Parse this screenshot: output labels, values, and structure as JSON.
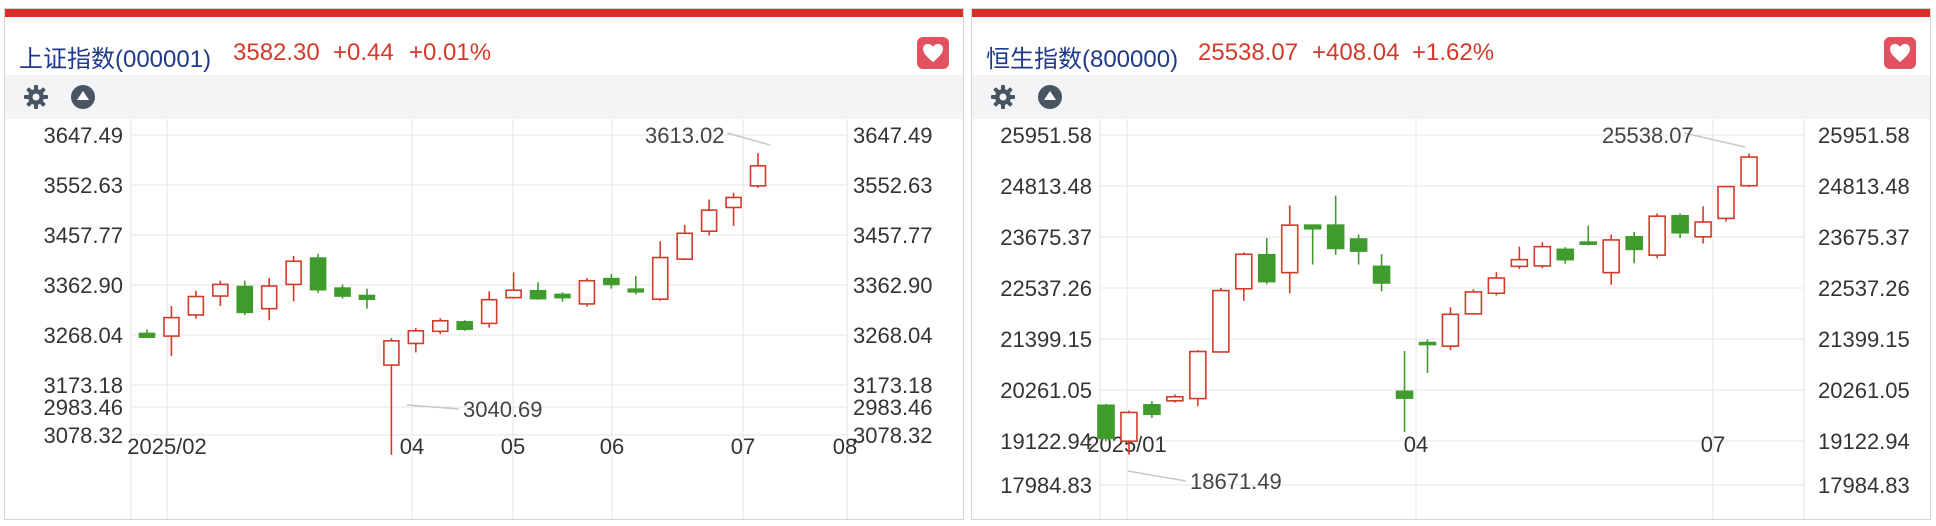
{
  "colors": {
    "up": "#d23a2a",
    "down": "#3f9b2c",
    "accent": "#d9302b",
    "title": "#1f3a8a",
    "fav": "#e05260"
  },
  "icons": {
    "favorite": "heart-icon",
    "settings": "gear-icon",
    "collapse": "collapse-up-icon"
  },
  "panels": [
    {
      "header": {
        "title": "上证指数(000001)",
        "price": "3582.30",
        "change": "+0.44",
        "percent": "+0.01%"
      },
      "chart_data": {
        "type": "candlestick",
        "y_ticks": [
          "3647.49",
          "3552.63",
          "3457.77",
          "3362.90",
          "3268.04",
          "3173.18",
          "3078.32",
          "2983.46"
        ],
        "x_ticks": [
          "2025/02",
          "04",
          "05",
          "06",
          "07",
          "08"
        ],
        "annotations": {
          "high": "3613.02",
          "low": "3040.69"
        },
        "candles": [
          {
            "o": 3271,
            "c": 3264,
            "h": 3279,
            "l": 3262
          },
          {
            "o": 3266,
            "c": 3301,
            "h": 3323,
            "l": 3228
          },
          {
            "o": 3306,
            "c": 3341,
            "h": 3352,
            "l": 3299
          },
          {
            "o": 3342,
            "c": 3364,
            "h": 3371,
            "l": 3323
          },
          {
            "o": 3360,
            "c": 3311,
            "h": 3371,
            "l": 3306
          },
          {
            "o": 3318,
            "c": 3361,
            "h": 3376,
            "l": 3296
          },
          {
            "o": 3364,
            "c": 3408,
            "h": 3418,
            "l": 3332
          },
          {
            "o": 3414,
            "c": 3354,
            "h": 3422,
            "l": 3348
          },
          {
            "o": 3357,
            "c": 3342,
            "h": 3364,
            "l": 3337
          },
          {
            "o": 3343,
            "c": 3336,
            "h": 3356,
            "l": 3318
          },
          {
            "o": 3211,
            "c": 3257,
            "h": 3262,
            "l": 3040.69
          },
          {
            "o": 3252,
            "c": 3276,
            "h": 3281,
            "l": 3235
          },
          {
            "o": 3275,
            "c": 3295,
            "h": 3300,
            "l": 3270
          },
          {
            "o": 3293,
            "c": 3279,
            "h": 3296,
            "l": 3276
          },
          {
            "o": 3290,
            "c": 3335,
            "h": 3351,
            "l": 3282
          },
          {
            "o": 3339,
            "c": 3353,
            "h": 3387,
            "l": 3337
          },
          {
            "o": 3352,
            "c": 3337,
            "h": 3368,
            "l": 3335
          },
          {
            "o": 3345,
            "c": 3339,
            "h": 3349,
            "l": 3331
          },
          {
            "o": 3327,
            "c": 3371,
            "h": 3376,
            "l": 3322
          },
          {
            "o": 3375,
            "c": 3364,
            "h": 3384,
            "l": 3356
          },
          {
            "o": 3355,
            "c": 3350,
            "h": 3380,
            "l": 3345
          },
          {
            "o": 3336,
            "c": 3415,
            "h": 3446,
            "l": 3333
          },
          {
            "o": 3412,
            "c": 3461,
            "h": 3477,
            "l": 3410
          },
          {
            "o": 3465,
            "c": 3505,
            "h": 3525,
            "l": 3457
          },
          {
            "o": 3510,
            "c": 3529,
            "h": 3538,
            "l": 3475
          },
          {
            "o": 3551,
            "c": 3589,
            "h": 3613.02,
            "l": 3547
          }
        ]
      }
    },
    {
      "header": {
        "title": "恒生指数(800000)",
        "price": "25538.07",
        "change": "+408.04",
        "percent": "+1.62%"
      },
      "chart_data": {
        "type": "candlestick",
        "y_ticks": [
          "25951.58",
          "24813.48",
          "23675.37",
          "22537.26",
          "21399.15",
          "20261.05",
          "19122.94",
          "17984.83"
        ],
        "x_ticks": [
          "2025/01",
          "04",
          "07"
        ],
        "annotations": {
          "high": "25538.07",
          "low": "18671.49"
        },
        "candles": [
          {
            "o": 19920,
            "c": 19180,
            "h": 19950,
            "l": 19120
          },
          {
            "o": 19120,
            "c": 19760,
            "h": 19800,
            "l": 18820
          },
          {
            "o": 19930,
            "c": 19720,
            "h": 20010,
            "l": 19640
          },
          {
            "o": 20020,
            "c": 20110,
            "h": 20160,
            "l": 19980
          },
          {
            "o": 20070,
            "c": 21120,
            "h": 21150,
            "l": 19900
          },
          {
            "o": 21110,
            "c": 22480,
            "h": 22540,
            "l": 21090
          },
          {
            "o": 22520,
            "c": 23290,
            "h": 23330,
            "l": 22250
          },
          {
            "o": 23280,
            "c": 22680,
            "h": 23650,
            "l": 22620
          },
          {
            "o": 22880,
            "c": 23940,
            "h": 24380,
            "l": 22420
          },
          {
            "o": 23940,
            "c": 23860,
            "h": 23950,
            "l": 23060
          },
          {
            "o": 23940,
            "c": 23420,
            "h": 24600,
            "l": 23280
          },
          {
            "o": 23630,
            "c": 23360,
            "h": 23730,
            "l": 23060
          },
          {
            "o": 23020,
            "c": 22650,
            "h": 23290,
            "l": 22460
          },
          {
            "o": 20230,
            "c": 20080,
            "h": 21130,
            "l": 19320
          },
          {
            "o": 21320,
            "c": 21300,
            "h": 21390,
            "l": 20640
          },
          {
            "o": 21240,
            "c": 21950,
            "h": 22110,
            "l": 21150
          },
          {
            "o": 21960,
            "c": 22450,
            "h": 22510,
            "l": 21980
          },
          {
            "o": 22420,
            "c": 22760,
            "h": 22890,
            "l": 22370
          },
          {
            "o": 23020,
            "c": 23170,
            "h": 23460,
            "l": 22960
          },
          {
            "o": 23030,
            "c": 23460,
            "h": 23560,
            "l": 22980
          },
          {
            "o": 23400,
            "c": 23170,
            "h": 23450,
            "l": 23080
          },
          {
            "o": 23560,
            "c": 23530,
            "h": 23930,
            "l": 23490
          },
          {
            "o": 22880,
            "c": 23610,
            "h": 23730,
            "l": 22610
          },
          {
            "o": 23680,
            "c": 23400,
            "h": 23790,
            "l": 23090
          },
          {
            "o": 23270,
            "c": 24140,
            "h": 24200,
            "l": 23200
          },
          {
            "o": 24150,
            "c": 23770,
            "h": 24200,
            "l": 23650
          },
          {
            "o": 23680,
            "c": 24010,
            "h": 24360,
            "l": 23530
          },
          {
            "o": 24090,
            "c": 24800,
            "h": 24820,
            "l": 24020
          },
          {
            "o": 24820,
            "c": 25460,
            "h": 25538.07,
            "l": 24790
          }
        ]
      }
    }
  ]
}
